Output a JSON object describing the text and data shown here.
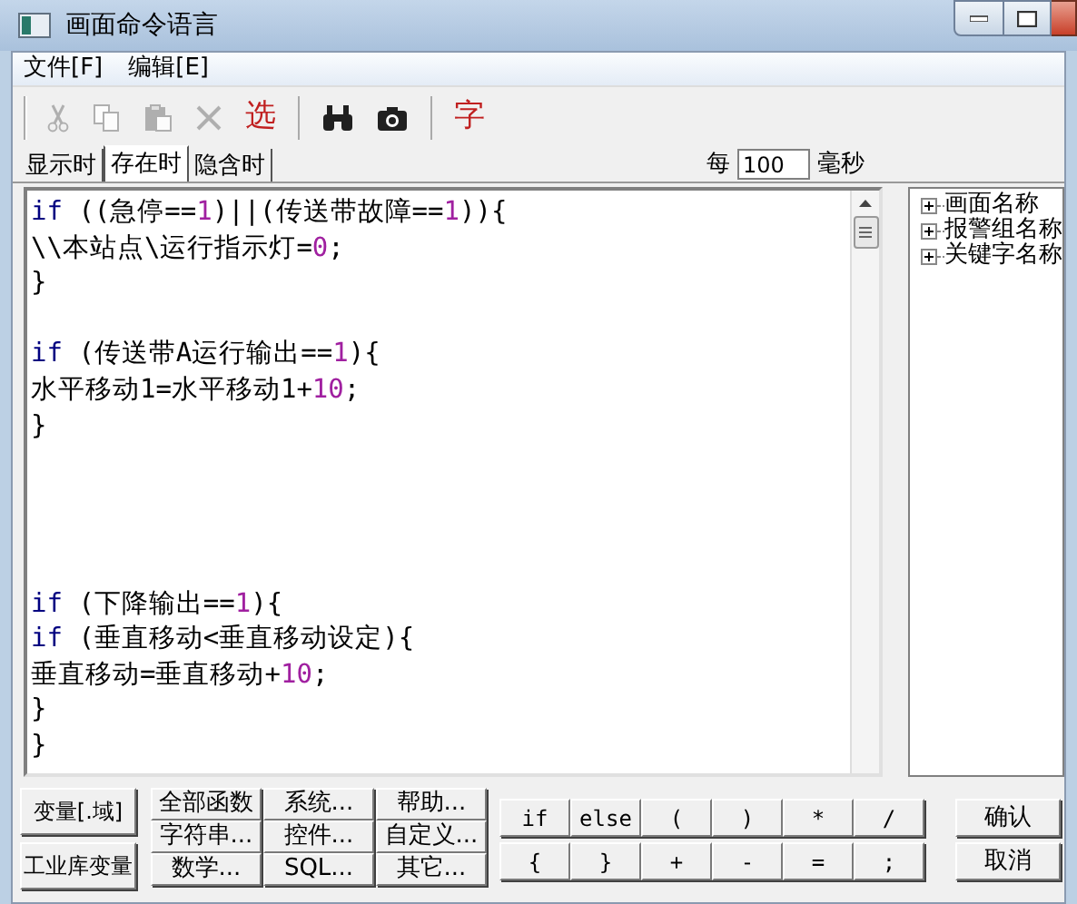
{
  "window": {
    "title": "画面命令语言"
  },
  "menu": [
    "文件[F]",
    "编辑[E]"
  ],
  "toolbar": [
    {
      "kind": "cut",
      "disabled": true
    },
    {
      "kind": "copy",
      "disabled": true
    },
    {
      "kind": "paste",
      "disabled": true
    },
    {
      "kind": "delete",
      "disabled": true
    },
    {
      "kind": "text",
      "label": "选",
      "disabled": false
    },
    {
      "kind": "separator"
    },
    {
      "kind": "find",
      "disabled": false
    },
    {
      "kind": "camera",
      "disabled": false
    },
    {
      "kind": "separator"
    },
    {
      "kind": "text",
      "label": "字",
      "disabled": false
    }
  ],
  "tabs": [
    {
      "label": "显示时",
      "selected": false
    },
    {
      "label": "存在时",
      "selected": true
    },
    {
      "label": "隐含时",
      "selected": false
    }
  ],
  "interval": {
    "label": "每",
    "value": "100",
    "unit": "毫秒"
  },
  "code_lines": [
    {
      "kind": "code",
      "tokens": [
        {
          "kind": "keyword",
          "text": "if"
        },
        {
          "kind": "plain",
          "text": " ((急停=="
        },
        {
          "kind": "number",
          "text": "1"
        },
        {
          "kind": "plain",
          "text": ")||(传送带故障=="
        },
        {
          "kind": "number",
          "text": "1"
        },
        {
          "kind": "plain",
          "text": ")){"
        }
      ]
    },
    {
      "kind": "code",
      "tokens": [
        {
          "kind": "plain",
          "text": "\\\\本站点\\运行指示灯="
        },
        {
          "kind": "number",
          "text": "0"
        },
        {
          "kind": "plain",
          "text": ";"
        }
      ]
    },
    {
      "kind": "code",
      "tokens": [
        {
          "kind": "plain",
          "text": "}"
        }
      ]
    },
    {
      "kind": "blank"
    },
    {
      "kind": "code",
      "tokens": [
        {
          "kind": "keyword",
          "text": "if"
        },
        {
          "kind": "plain",
          "text": " (传送带A运行输出=="
        },
        {
          "kind": "number",
          "text": "1"
        },
        {
          "kind": "plain",
          "text": "){"
        }
      ]
    },
    {
      "kind": "code",
      "tokens": [
        {
          "kind": "plain",
          "text": "水平移动1=水平移动1+"
        },
        {
          "kind": "number",
          "text": "10"
        },
        {
          "kind": "plain",
          "text": ";"
        }
      ]
    },
    {
      "kind": "code",
      "tokens": [
        {
          "kind": "plain",
          "text": "}"
        }
      ]
    },
    {
      "kind": "blank"
    },
    {
      "kind": "blank"
    },
    {
      "kind": "blank"
    },
    {
      "kind": "blank"
    },
    {
      "kind": "code",
      "tokens": [
        {
          "kind": "keyword",
          "text": "if"
        },
        {
          "kind": "plain",
          "text": " (下降输出=="
        },
        {
          "kind": "number",
          "text": "1"
        },
        {
          "kind": "plain",
          "text": "){"
        }
      ]
    },
    {
      "kind": "code",
      "tokens": [
        {
          "kind": "keyword",
          "text": "if"
        },
        {
          "kind": "plain",
          "text": " (垂直移动<垂直移动设定){"
        }
      ]
    },
    {
      "kind": "code",
      "tokens": [
        {
          "kind": "plain",
          "text": "垂直移动=垂直移动+"
        },
        {
          "kind": "number",
          "text": "10"
        },
        {
          "kind": "plain",
          "text": ";"
        }
      ]
    },
    {
      "kind": "code",
      "tokens": [
        {
          "kind": "plain",
          "text": "}"
        }
      ]
    },
    {
      "kind": "code",
      "tokens": [
        {
          "kind": "plain",
          "text": "}"
        }
      ]
    }
  ],
  "tree": [
    {
      "label": "画面名称",
      "expanded": false
    },
    {
      "label": "报警组名称",
      "expanded": false
    },
    {
      "label": "关键字名称",
      "expanded": false
    }
  ],
  "variable_buttons": [
    "变量[.域]",
    "工业库变量"
  ],
  "function_buttons": [
    "全部函数",
    "系统...",
    "帮助...",
    "字符串...",
    "控件...",
    "自定义...",
    "数学...",
    "SQL...",
    "其它..."
  ],
  "operator_buttons": [
    "if",
    "else",
    "(",
    ")",
    "*",
    "/",
    "{",
    "}",
    "+",
    "-",
    "=",
    ";"
  ],
  "dialog_buttons": [
    "确认",
    "取消"
  ]
}
